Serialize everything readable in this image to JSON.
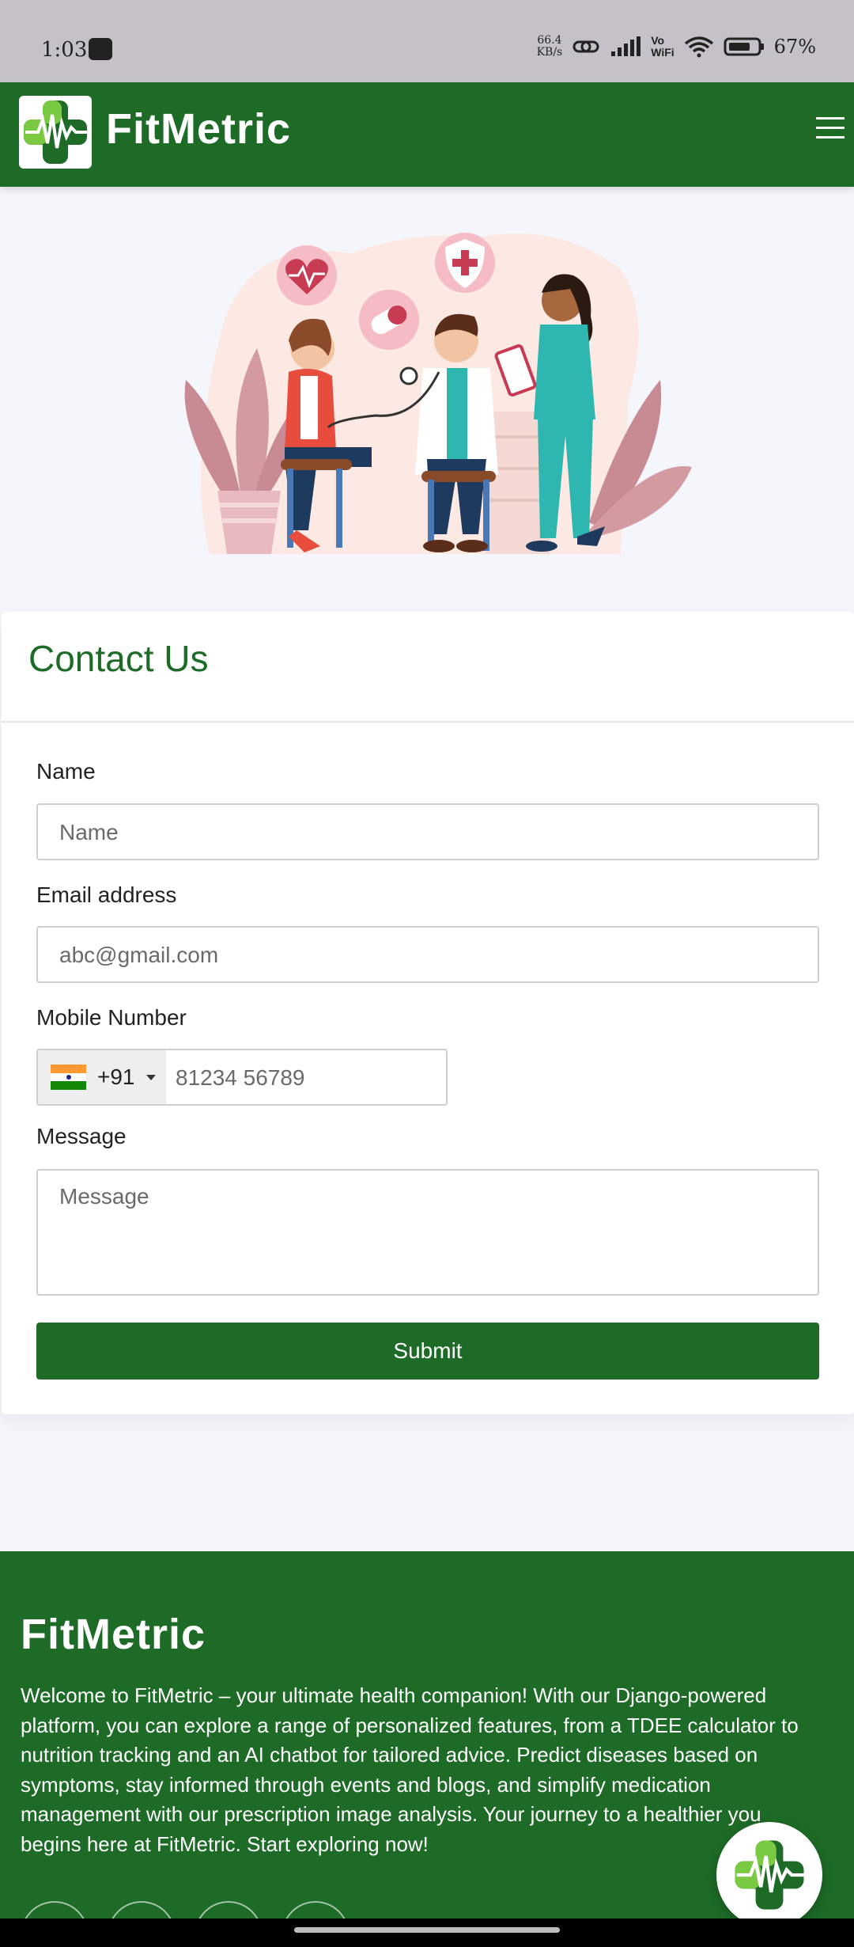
{
  "status_bar": {
    "time": "1:03",
    "speed_value": "66.4",
    "speed_unit": "KB/s",
    "wifi_text_top": "Vo",
    "wifi_text_bottom": "WiFi",
    "battery": "67%"
  },
  "navbar": {
    "brand": "FitMetric"
  },
  "contact": {
    "title": "Contact Us",
    "name_label": "Name",
    "name_placeholder": "Name",
    "email_label": "Email address",
    "email_placeholder": "abc@gmail.com",
    "mobile_label": "Mobile Number",
    "country_code": "+91",
    "mobile_placeholder": "81234 56789",
    "message_label": "Message",
    "message_placeholder": "Message",
    "submit_label": "Submit"
  },
  "footer": {
    "title": "FitMetric",
    "description": "Welcome to FitMetric – your ultimate health companion! With our Django-powered platform, you can explore a range of personalized features, from a TDEE calculator to nutrition tracking and an AI chatbot for tailored advice. Predict diseases based on symptoms, stay informed through events and blogs, and simplify medication management with our prescription image analysis. Your journey to a healthier you begins here at FitMetric. Start exploring now!"
  },
  "colors": {
    "brand_green": "#1d6b27",
    "logo_light_green": "#7ac943",
    "page_background": "#f4f6fc"
  },
  "icons": {
    "logo": "health-cross-heartbeat-icon",
    "menu": "hamburger-menu-icon",
    "flag": "india-flag-icon",
    "chat": "chatbot-logo-icon"
  }
}
